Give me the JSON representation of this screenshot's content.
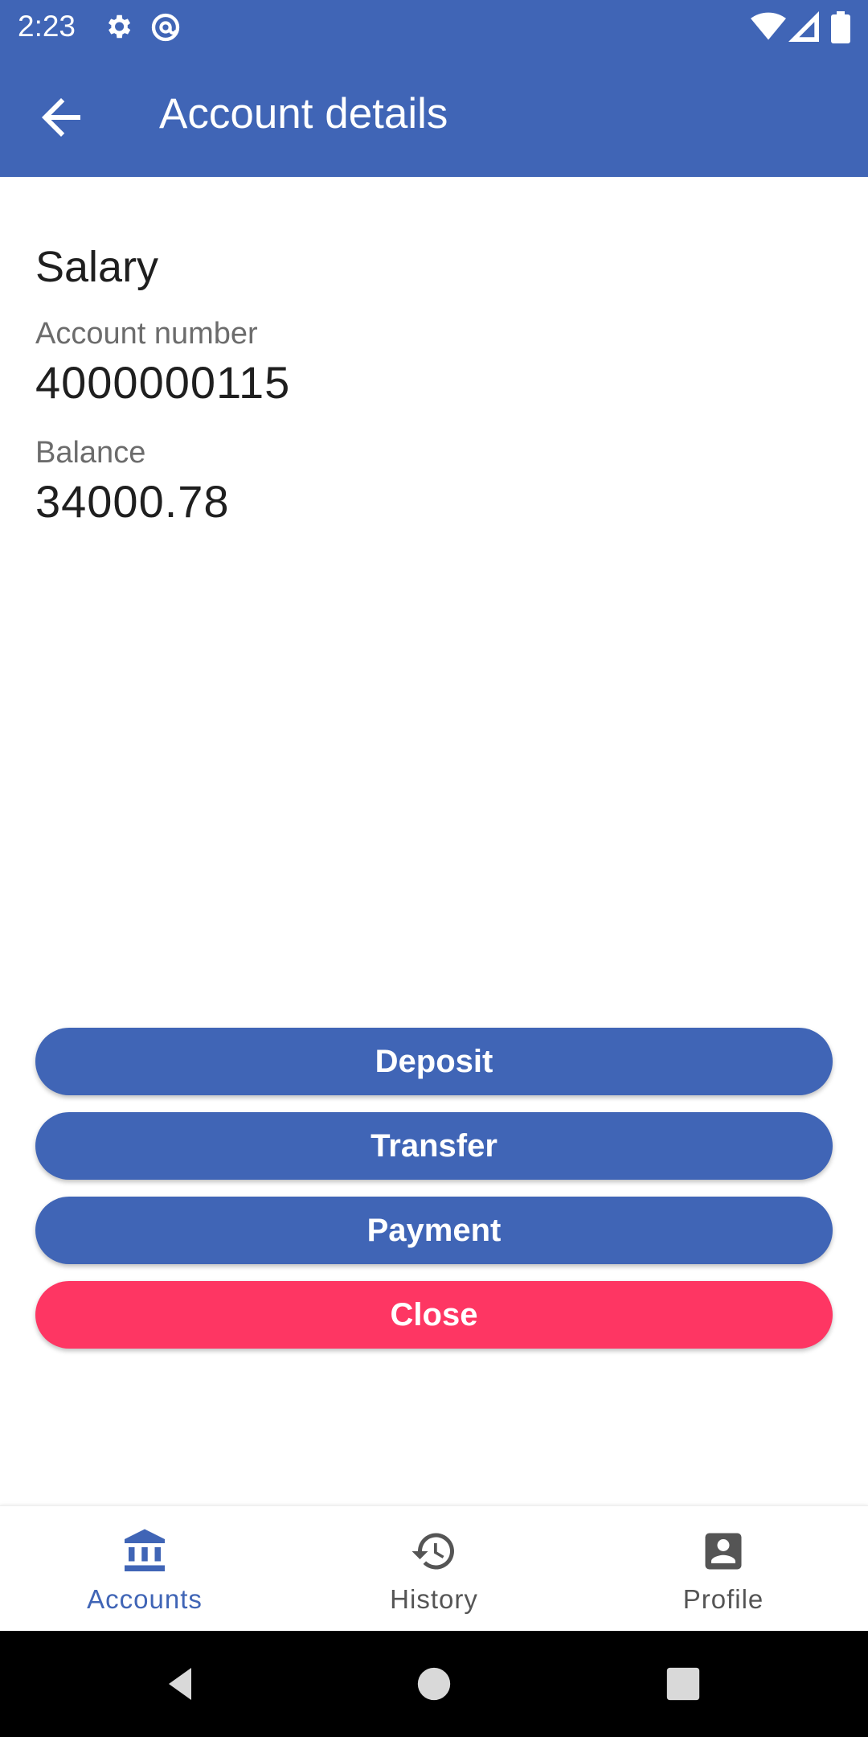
{
  "status_bar": {
    "time": "2:23",
    "icons": [
      "settings-icon",
      "at-sign-icon",
      "wifi-icon",
      "signal-icon",
      "battery-icon"
    ]
  },
  "app_bar": {
    "title": "Account details",
    "back_icon": "arrow-back-icon"
  },
  "account": {
    "name": "Salary",
    "number_label": "Account number",
    "number": "4000000115",
    "balance_label": "Balance",
    "balance": "34000.78"
  },
  "actions": {
    "deposit": "Deposit",
    "transfer": "Transfer",
    "payment": "Payment",
    "close": "Close"
  },
  "bottom_nav": {
    "items": [
      {
        "label": "Accounts",
        "icon": "bank-icon",
        "active": true
      },
      {
        "label": "History",
        "icon": "history-icon",
        "active": false
      },
      {
        "label": "Profile",
        "icon": "profile-icon",
        "active": false
      }
    ]
  },
  "colors": {
    "primary": "#4065b6",
    "danger": "#fe3663",
    "inactive": "#555555",
    "background": "#ffffff"
  }
}
